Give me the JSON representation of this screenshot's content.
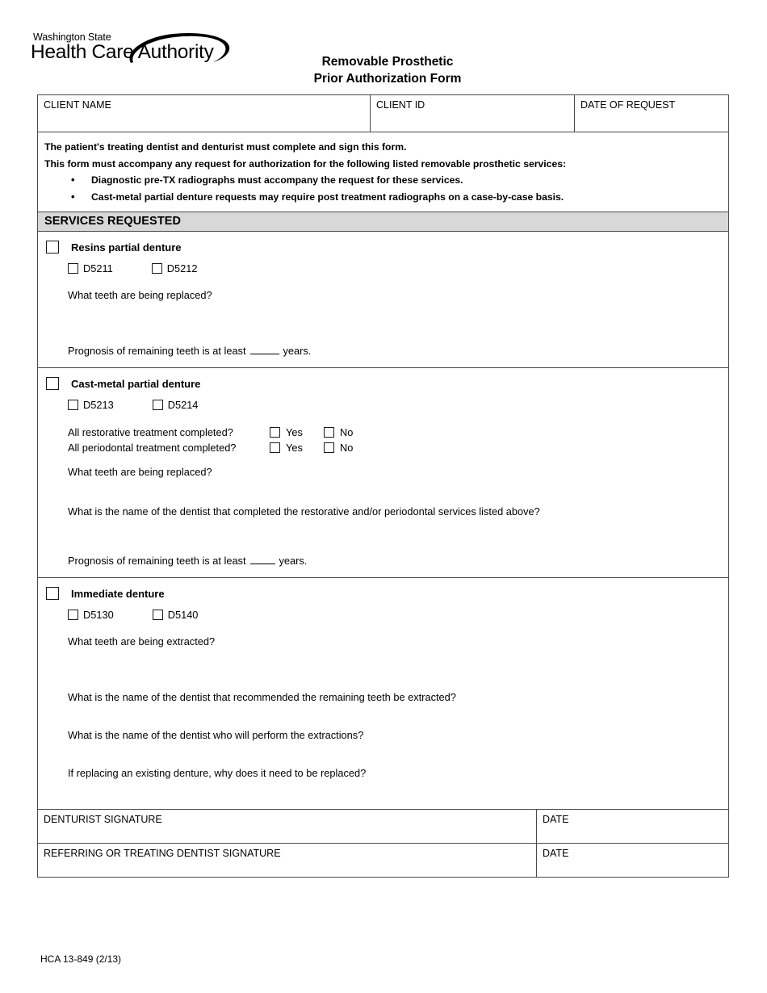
{
  "agency": {
    "line1": "Washington State",
    "line2": "Health Care Authority",
    "logo_icon": "swoosh-ellipse-icon"
  },
  "document": {
    "title_line1": "Removable Prosthetic",
    "title_line2": "Prior Authorization Form",
    "form_number": "HCA 13-849 (2/13)"
  },
  "client_row": {
    "client_name_label": "CLIENT NAME",
    "client_name_value": "",
    "client_id_label": "CLIENT ID",
    "client_id_value": "",
    "date_of_request_label": "DATE OF REQUEST",
    "date_of_request_value": ""
  },
  "instructions": {
    "line1": "The patient's treating dentist and denturist must complete and sign this form.",
    "line2": "This form must accompany any request for authorization for the following listed removable prosthetic services:",
    "bullets": [
      "Diagnostic pre-TX radiographs must accompany the request for these services.",
      "Cast-metal partial denture requests may require post treatment radiographs on a case-by-case basis."
    ]
  },
  "services_header": "SERVICES REQUESTED",
  "sections": [
    {
      "title": "Resins partial denture",
      "checked": false,
      "codes": [
        {
          "code": "D5211",
          "checked": false
        },
        {
          "code": "D5212",
          "checked": false
        }
      ],
      "question_teeth": "What teeth are being replaced?",
      "answer_teeth": "",
      "prognosis_prefix": "Prognosis of remaining teeth is at least",
      "prognosis_value": "",
      "prognosis_suffix": "years."
    },
    {
      "title": "Cast-metal partial denture",
      "checked": false,
      "codes": [
        {
          "code": "D5213",
          "checked": false
        },
        {
          "code": "D5214",
          "checked": false
        }
      ],
      "yes_no_rows": [
        {
          "label": "All restorative treatment completed?",
          "yes_label": "Yes",
          "no_label": "No",
          "yes_checked": false,
          "no_checked": false
        },
        {
          "label": "All periodontal treatment completed?",
          "yes_label": "Yes",
          "no_label": "No",
          "yes_checked": false,
          "no_checked": false
        }
      ],
      "question_teeth": "What teeth are being replaced?",
      "answer_teeth": "",
      "question_dentist": "What is the name of the dentist that completed the restorative and/or periodontal services listed above?",
      "answer_dentist": "",
      "prognosis_prefix": "Prognosis of remaining teeth is at least",
      "prognosis_value": "",
      "prognosis_suffix": "years."
    },
    {
      "title": "Immediate denture",
      "checked": false,
      "codes": [
        {
          "code": "D5130",
          "checked": false
        },
        {
          "code": "D5140",
          "checked": false
        }
      ],
      "question_extracted": "What teeth are being extracted?",
      "answer_extracted": "",
      "question_recommended": "What is the name of the dentist that recommended the remaining teeth be extracted?",
      "answer_recommended": "",
      "question_performer": "What is the name of the dentist who will perform the extractions?",
      "answer_performer": "",
      "question_replace": "If replacing an existing denture, why does it need to be replaced?",
      "answer_replace": ""
    }
  ],
  "signatures": [
    {
      "signature_label": "DENTURIST SIGNATURE",
      "signature_value": "",
      "date_label": "DATE",
      "date_value": ""
    },
    {
      "signature_label": "REFERRING OR TREATING DENTIST SIGNATURE",
      "signature_value": "",
      "date_label": "DATE",
      "date_value": ""
    }
  ],
  "colors": {
    "section_header_bg": "#d8d8d8",
    "border": "#4a4a4a",
    "text": "#000000"
  }
}
